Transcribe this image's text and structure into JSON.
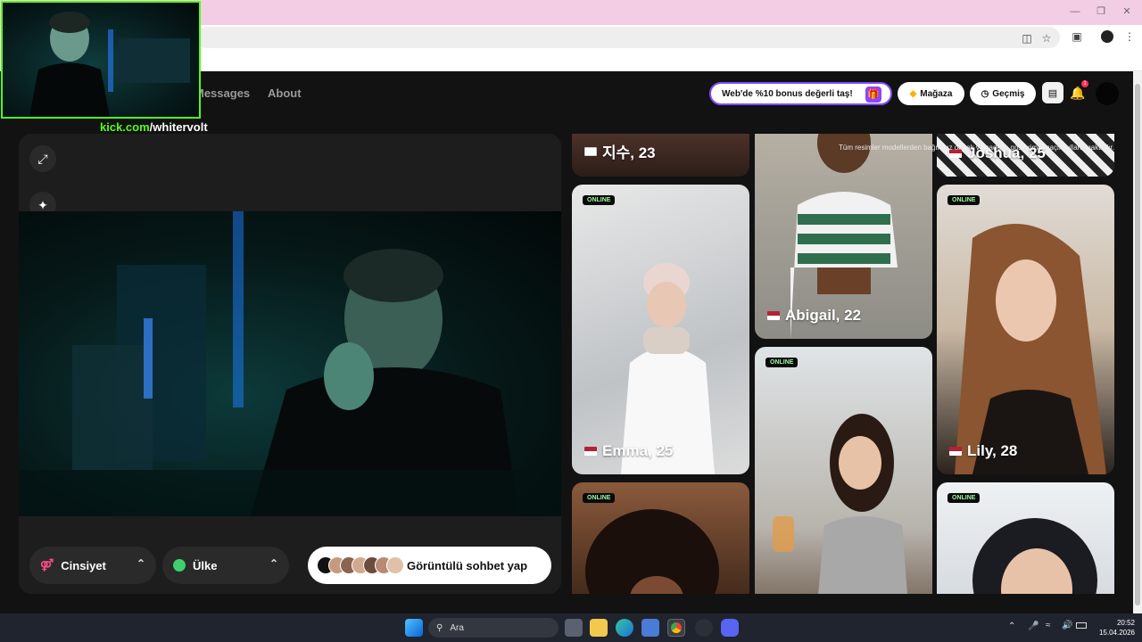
{
  "nav": {
    "messages_label": "Messages",
    "about_label": "About"
  },
  "header": {
    "promo_text": "Web'de %10 bonus değerli taş!",
    "store_label": "Mağaza",
    "history_label": "Geçmiş",
    "notification_count": "1"
  },
  "controls": {
    "gender_label": "Cinsiyet",
    "country_label": "Ülke",
    "start_label": "Görüntülü sohbet yap"
  },
  "gallery": {
    "disclaimer": "Tüm resimler modellerden bağımsız olarak ve sadece gösterim amaçlı kullanılmaktadır.",
    "online_label": "ONLINE",
    "cards": [
      {
        "name": "지수, 23",
        "flag": "kr-flag",
        "online": false
      },
      {
        "name": "Abigail, 22",
        "flag": "us-flag",
        "online": false
      },
      {
        "name": "Joshua, 25",
        "flag": "us-flag",
        "online": false
      },
      {
        "name": "Emma, 25",
        "flag": "us-flag",
        "online": true
      },
      {
        "name": "Lily, 28",
        "flag": "us-flag",
        "online": true
      },
      {
        "name": "",
        "flag": "",
        "online": true
      },
      {
        "name": "",
        "flag": "",
        "online": true
      },
      {
        "name": "",
        "flag": "",
        "online": true
      }
    ]
  },
  "overlay": {
    "site": "kick.com",
    "channel": "/whitervolt",
    "accent": "#53fc18"
  },
  "taskbar": {
    "search_placeholder": "Ara",
    "time": "20:52",
    "date": "15.04.2026"
  },
  "colors": {
    "accent_purple": "#7c4dff",
    "online_green": "#9bf7a1",
    "titlebar_pink": "#f3cde3"
  }
}
